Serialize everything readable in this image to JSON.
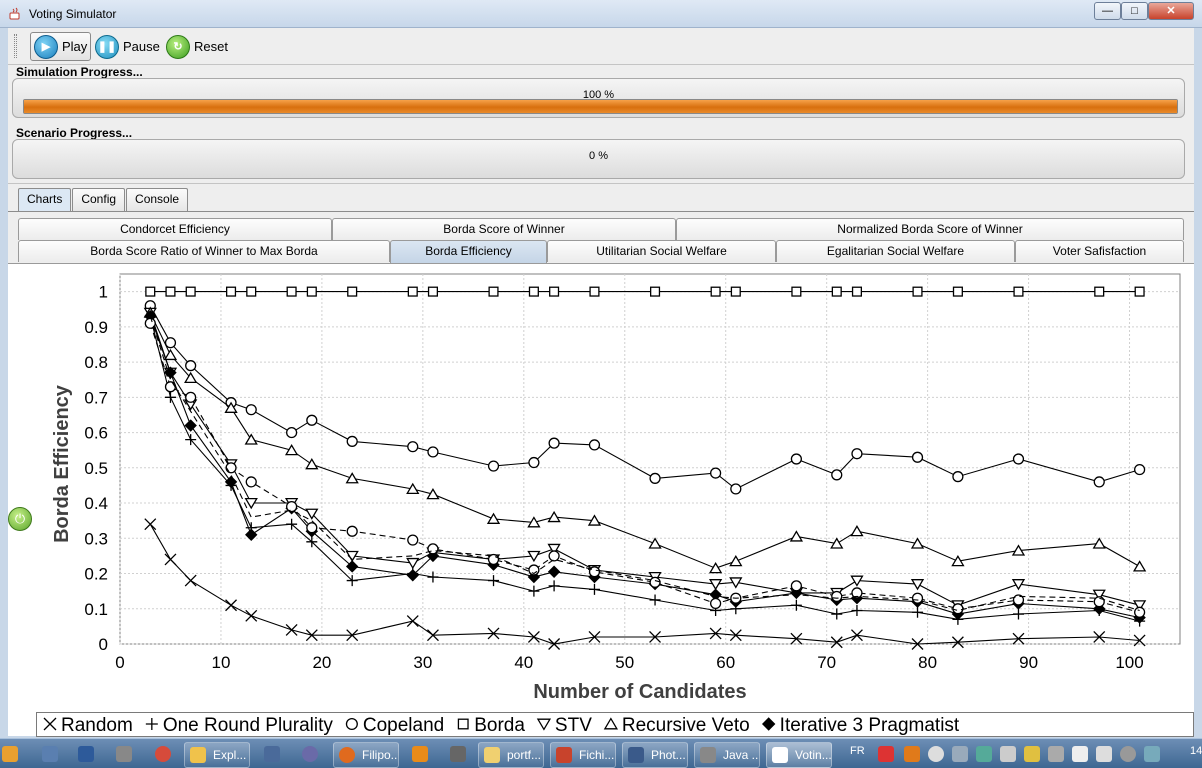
{
  "window": {
    "title": "Voting Simulator",
    "min_glyph": "—",
    "max_glyph": "□",
    "close_glyph": "✕"
  },
  "toolbar": {
    "play_label": "Play",
    "pause_label": "Pause",
    "reset_label": "Reset"
  },
  "simulation_progress": {
    "label": "Simulation Progress...",
    "text": "100 %",
    "fraction": 1.0
  },
  "scenario_progress": {
    "label": "Scenario Progress...",
    "text": "0 %",
    "fraction": 0.0
  },
  "main_tabs": [
    "Charts",
    "Config",
    "Console"
  ],
  "active_main_tab": "Charts",
  "sub_tabs_row1": [
    "Condorcet Efficiency",
    "Borda Score of Winner",
    "Normalized Borda Score of Winner"
  ],
  "sub_tabs_row2": [
    "Borda Score Ratio of Winner to Max Borda",
    "Borda Efficiency",
    "Utilitarian Social Welfare",
    "Egalitarian Social Welfare",
    "Voter Safisfaction"
  ],
  "active_sub_tab": "Borda Efficiency",
  "colors": {
    "progress_fill": "#e07a1a",
    "active_tab": "#c8d8ea",
    "taskbar": "#4f76a0"
  },
  "chart_data": {
    "type": "line",
    "title": "",
    "xlabel": "Number of Candidates",
    "ylabel": "Borda Efficiency",
    "xlim": [
      0,
      105
    ],
    "ylim": [
      0,
      1.05
    ],
    "xticks": [
      "0",
      "10",
      "20",
      "30",
      "40",
      "50",
      "60",
      "70",
      "80",
      "90",
      "100"
    ],
    "yticks": [
      "0",
      "0.1",
      "0.2",
      "0.3",
      "0.4",
      "0.5",
      "0.6",
      "0.7",
      "0.8",
      "0.9",
      "1"
    ],
    "grid": true,
    "legend_position": "bottom",
    "x": [
      3,
      5,
      7,
      11,
      13,
      17,
      19,
      23,
      29,
      31,
      37,
      41,
      43,
      47,
      53,
      59,
      61,
      67,
      71,
      73,
      79,
      83,
      89,
      97,
      101
    ],
    "series": [
      {
        "name": "Random",
        "marker": "x",
        "dash": false,
        "values": [
          0.34,
          0.24,
          0.18,
          0.11,
          0.08,
          0.04,
          0.025,
          0.025,
          0.065,
          0.025,
          0.03,
          0.02,
          0.0,
          0.02,
          0.02,
          0.03,
          0.025,
          0.015,
          0.005,
          0.025,
          0.0,
          0.005,
          0.015,
          0.02,
          0.01
        ]
      },
      {
        "name": "One Round Plurality",
        "marker": "plus",
        "dash": false,
        "values": [
          0.93,
          0.7,
          0.58,
          0.45,
          0.33,
          0.34,
          0.29,
          0.18,
          0.2,
          0.19,
          0.18,
          0.15,
          0.165,
          0.155,
          0.125,
          0.095,
          0.1,
          0.11,
          0.085,
          0.095,
          0.09,
          0.07,
          0.085,
          0.095,
          0.065
        ]
      },
      {
        "name": "Copeland",
        "marker": "circle",
        "dash": false,
        "values": [
          0.96,
          0.855,
          0.79,
          0.685,
          0.665,
          0.6,
          0.635,
          0.575,
          0.56,
          0.545,
          0.505,
          0.515,
          0.57,
          0.565,
          0.47,
          0.485,
          0.44,
          0.525,
          0.48,
          0.54,
          0.53,
          0.475,
          0.525,
          0.46,
          0.495
        ]
      },
      {
        "name": "Borda",
        "marker": "square",
        "dash": false,
        "values": [
          1,
          1,
          1,
          1,
          1,
          1,
          1,
          1,
          1,
          1,
          1,
          1,
          1,
          1,
          1,
          1,
          1,
          1,
          1,
          1,
          1,
          1,
          1,
          1,
          1
        ]
      },
      {
        "name": "STV",
        "marker": "triangle-down",
        "dash": false,
        "values": [
          0.94,
          0.77,
          0.68,
          0.51,
          0.4,
          0.4,
          0.37,
          0.25,
          0.23,
          0.26,
          0.24,
          0.25,
          0.27,
          0.21,
          0.19,
          0.17,
          0.175,
          0.145,
          0.145,
          0.18,
          0.17,
          0.11,
          0.17,
          0.14,
          0.11
        ]
      },
      {
        "name": "Recursive Veto",
        "marker": "triangle-up",
        "dash": false,
        "values": [
          0.94,
          0.82,
          0.755,
          0.67,
          0.58,
          0.55,
          0.51,
          0.47,
          0.44,
          0.425,
          0.355,
          0.345,
          0.36,
          0.35,
          0.285,
          0.215,
          0.235,
          0.305,
          0.285,
          0.32,
          0.285,
          0.235,
          0.265,
          0.285,
          0.22
        ]
      },
      {
        "name": "Iterative 3 Pragmatist",
        "marker": "diamond",
        "dash": false,
        "values": [
          0.93,
          0.77,
          0.62,
          0.46,
          0.31,
          0.385,
          0.32,
          0.22,
          0.195,
          0.25,
          0.225,
          0.19,
          0.205,
          0.19,
          0.17,
          0.14,
          0.12,
          0.145,
          0.125,
          0.13,
          0.12,
          0.085,
          0.115,
          0.1,
          0.075
        ]
      },
      {
        "name": "",
        "marker": "circle",
        "dash": true,
        "values": [
          0.91,
          0.73,
          0.7,
          0.5,
          0.46,
          0.39,
          0.33,
          0.32,
          0.295,
          0.27,
          0.24,
          0.21,
          0.25,
          0.205,
          0.175,
          0.115,
          0.13,
          0.165,
          0.135,
          0.145,
          0.13,
          0.1,
          0.125,
          0.12,
          0.09
        ]
      },
      {
        "name": "",
        "marker": "none",
        "dash": true,
        "values": [
          0.93,
          0.75,
          0.66,
          0.48,
          0.36,
          0.38,
          0.35,
          0.24,
          0.25,
          0.265,
          0.25,
          0.2,
          0.24,
          0.21,
          0.18,
          0.135,
          0.13,
          0.14,
          0.13,
          0.135,
          0.125,
          0.095,
          0.135,
          0.13,
          0.095
        ]
      }
    ]
  },
  "taskbar": {
    "items": [
      "Expl...",
      "Filipo...",
      "portf...",
      "Fichi...",
      "Phot...",
      "Java ...",
      "Votin..."
    ],
    "lang": "FR",
    "clock": "14"
  }
}
